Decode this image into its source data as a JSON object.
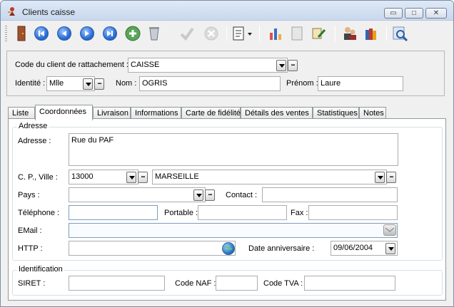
{
  "window": {
    "title": "Clients caisse",
    "buttons": {
      "minimize": "▭",
      "maximize": "□",
      "close": "✕"
    }
  },
  "toolbar": {
    "icons": [
      "door-exit-icon",
      "first-record-icon",
      "previous-record-icon",
      "next-record-icon",
      "last-record-icon",
      "add-record-icon",
      "delete-record-icon",
      "validate-icon",
      "cancel-icon",
      "form-menu-icon",
      "chart-icon",
      "document-icon",
      "edit-icon",
      "users-icon",
      "books-icon",
      "search-icon"
    ]
  },
  "header": {
    "code_label": "Code du client de rattachement :",
    "code_value": "CAISSE",
    "identite_label": "Identité :",
    "identite_value": "Mlle",
    "nom_label": "Nom :",
    "nom_value": "OGRIS",
    "prenom_label": "Prénom :",
    "prenom_value": "Laure",
    "dots": "..."
  },
  "tabs": [
    "Liste",
    "Coordonnées",
    "Livraison",
    "Informations",
    "Carte de fidélité",
    "Détails des ventes",
    "Statistiques",
    "Notes"
  ],
  "active_tab": "Coordonnées",
  "adresse_group": {
    "title": "Adresse",
    "adresse_label": "Adresse :",
    "adresse_value": "Rue du PAF",
    "cp_ville_label": "C. P., Ville :",
    "cp_value": "13000",
    "ville_value": "MARSEILLE",
    "pays_label": "Pays :",
    "pays_value": "",
    "contact_label": "Contact :",
    "contact_value": "",
    "telephone_label": "Téléphone :",
    "telephone_value": "",
    "portable_label": "Portable :",
    "portable_value": "",
    "fax_label": "Fax :",
    "fax_value": "",
    "email_label": "EMail :",
    "email_value": "",
    "http_label": "HTTP :",
    "http_value": "",
    "date_label": "Date anniversaire :",
    "date_value": "09/06/2004"
  },
  "identification_group": {
    "title": "Identification",
    "siret_label": "SIRET :",
    "siret_value": "",
    "naf_label": "Code NAF :",
    "naf_value": "",
    "tva_label": "Code TVA :",
    "tva_value": ""
  }
}
